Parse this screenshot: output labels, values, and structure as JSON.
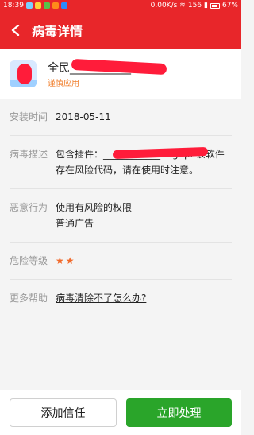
{
  "statusbar": {
    "time": "18:39",
    "net_speed": "0.00K/s",
    "signal": "156",
    "battery": "67%"
  },
  "header": {
    "title": "病毒详情"
  },
  "app": {
    "name": "全民___________玩",
    "tag": "谨慎应用"
  },
  "details": {
    "install_label": "安装时间",
    "install_value": "2018-05-11",
    "desc_label": "病毒描述",
    "desc_value": "包含插件：____________engapi 该软件存在风险代码，请在使用时注意。",
    "behavior_label": "恶意行为",
    "behavior_line1": "使用有风险的权限",
    "behavior_line2": "普通广告",
    "level_label": "危险等级",
    "level_stars": "★★",
    "help_label": "更多帮助",
    "help_link": "病毒清除不了怎么办?"
  },
  "footer": {
    "trust_label": "添加信任",
    "handle_label": "立即处理"
  }
}
